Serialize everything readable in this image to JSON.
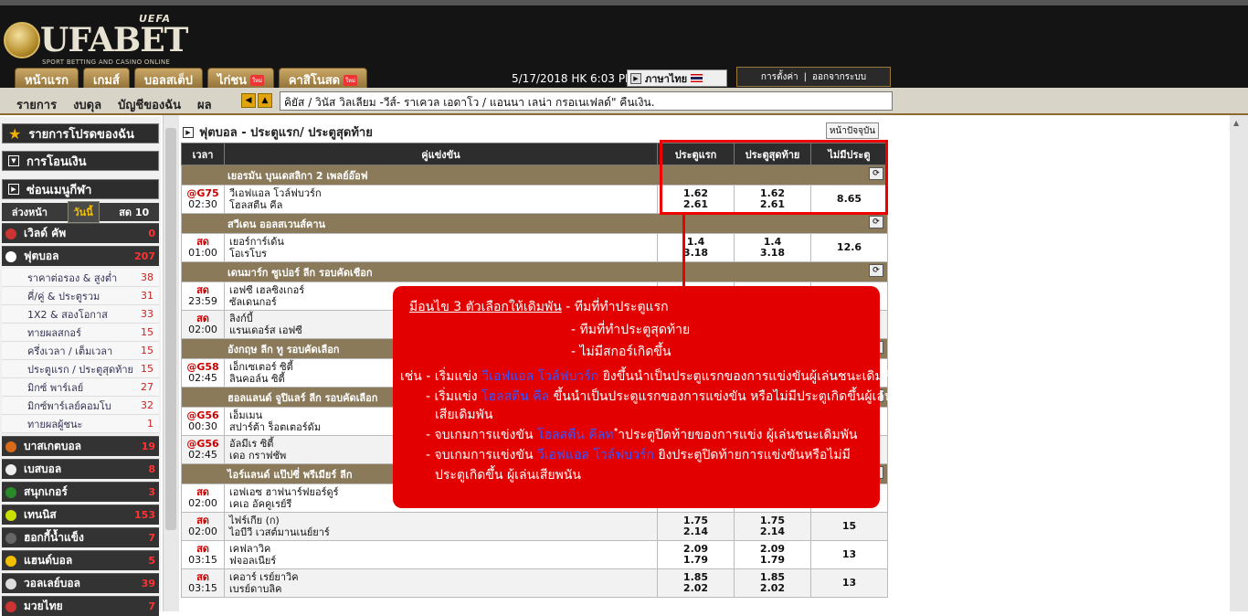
{
  "brand": {
    "name": "UFABET",
    "uefa": "UEFA",
    "tagline": "SPORT BETTING AND CASINO ONLINE"
  },
  "nav_tabs": [
    {
      "label": "หน้าแรก",
      "badge": ""
    },
    {
      "label": "เกมส์",
      "badge": ""
    },
    {
      "label": "บอลสเต็ป",
      "badge": ""
    },
    {
      "label": "ไก่ชน",
      "badge": "ใหม่"
    },
    {
      "label": "คาสิโนสด",
      "badge": "ใหม่"
    }
  ],
  "datetime": "5/17/2018 HK 6:03 PM",
  "language": "ภาษาไทย",
  "settings": {
    "label1": "การตั้งค่า",
    "sep": "|",
    "label2": "ออกจากระบบ"
  },
  "subnav": [
    "รายการ",
    "งบดุล",
    "บัญชีของฉัน",
    "ผล"
  ],
  "ticker": "คิยัส / วินัส วิลเลียม -วีส์- ราเควล เอดาโว / แอนนา เลน่า กรอเนเฟลด์\" คืนเงิน.",
  "sidebar": {
    "headers": [
      "รายการโปรดของฉัน",
      "การโอนเงิน",
      "ซ่อนเมนูกีฬา"
    ],
    "tabs": [
      "ล่วงหน้า",
      "วันนี้",
      "สด 10"
    ],
    "sports": [
      {
        "name": "เวิลด์ คัพ",
        "count": "0",
        "color": "#c33"
      },
      {
        "name": "ฟุตบอล",
        "count": "207",
        "color": "#fff"
      },
      {
        "name": "บาสเกตบอล",
        "count": "19",
        "color": "#d86a1a"
      },
      {
        "name": "เบสบอล",
        "count": "8",
        "color": "#eee"
      },
      {
        "name": "สนุกเกอร์",
        "count": "3",
        "color": "#2a8a2a"
      },
      {
        "name": "เทนนิส",
        "count": "153",
        "color": "#c9e000"
      },
      {
        "name": "ฮอกกี้น้ำแข็ง",
        "count": "7",
        "color": "#666"
      },
      {
        "name": "แฮนด์บอล",
        "count": "5",
        "color": "#f0c000"
      },
      {
        "name": "วอลเลย์บอล",
        "count": "39",
        "color": "#ddd"
      },
      {
        "name": "มวยไทย",
        "count": "7",
        "color": "#c33"
      }
    ],
    "football_sub": [
      {
        "name": "ราคาต่อรอง & สูงต่ำ",
        "count": "38"
      },
      {
        "name": "คี่/คู่ & ประตูรวม",
        "count": "31"
      },
      {
        "name": "1X2 & สองโอกาส",
        "count": "33"
      },
      {
        "name": "ทายผลสกอร์",
        "count": "15"
      },
      {
        "name": "ครึ่งเวลา / เต็มเวลา",
        "count": "15"
      },
      {
        "name": "ประตูแรก / ประตูสุดท้าย",
        "count": "15"
      },
      {
        "name": "มิกซ์ พาร์เลย์",
        "count": "27"
      },
      {
        "name": "มิกซ์พาร์เลย์คอมโบ",
        "count": "32"
      },
      {
        "name": "ทายผลผู้ชนะ",
        "count": "1"
      }
    ]
  },
  "page": {
    "title": "ฟุตบอล - ประตูแรก/ ประตูสุดท้าย",
    "now_button": "หน้าปัจจุบัน"
  },
  "table": {
    "headers": [
      "เวลา",
      "คู่แข่งขัน",
      "ประตูแรก",
      "ประตูสุดท้าย",
      "ไม่มีประตู"
    ],
    "rows": [
      {
        "type": "league",
        "name": "เยอรมัน บุนเดสลิกา 2 เพลย์อ๊อฟ"
      },
      {
        "type": "match",
        "live": "@G75",
        "time": "02:30",
        "home": "วีเอฟแอล โวล์ฟบวร์ก",
        "away": "โฮลสตีน คีล",
        "fg": [
          "1.62",
          "2.61"
        ],
        "lg": [
          "1.62",
          "2.61"
        ],
        "ng": "8.65"
      },
      {
        "type": "league",
        "name": "สวีเดน ออลสเวนส์คาน"
      },
      {
        "type": "match",
        "live": "สด",
        "time": "01:00",
        "home": "เยอร์การ์เด้น",
        "away": "โอเรโบร",
        "fg": [
          "1.4",
          "3.18"
        ],
        "lg": [
          "1.4",
          "3.18"
        ],
        "ng": "12.6"
      },
      {
        "type": "league",
        "name": "เดนมาร์ก ซูเปอร์ ลีก รอบคัดเชือก"
      },
      {
        "type": "match",
        "live": "สด",
        "time": "23:59",
        "home": "เอฟซี เฮลซิงเกอร์",
        "away": "ซัลเดนกอร์",
        "fg": [
          "",
          ""
        ],
        "lg": [
          "",
          ""
        ],
        "ng": ""
      },
      {
        "type": "match",
        "live": "สด",
        "time": "02:00",
        "home": "ลิงก์บี้",
        "away": "แรนเดอร์ส เอฟซี",
        "fg": [
          "",
          ""
        ],
        "lg": [
          "",
          ""
        ],
        "ng": ""
      },
      {
        "type": "league",
        "name": "อังกฤษ ลีก ทู รอบคัดเลือก"
      },
      {
        "type": "match",
        "live": "@G58",
        "time": "02:45",
        "home": "เอ็กเซเตอร์ ซิตี้",
        "away": "ลินคอล์น ซิตี้",
        "fg": [
          "",
          ""
        ],
        "lg": [
          "",
          ""
        ],
        "ng": ""
      },
      {
        "type": "league",
        "name": "ฮอลแลนด์ จูปิแลร์ ลีก รอบคัดเลือก"
      },
      {
        "type": "match",
        "live": "@G56",
        "time": "00:30",
        "home": "เอ็มเมน",
        "away": "สปาร์ต้า ร็อตเตอร์ดัม",
        "fg": [
          "",
          ""
        ],
        "lg": [
          "",
          ""
        ],
        "ng": ""
      },
      {
        "type": "match",
        "live": "@G56",
        "time": "02:45",
        "home": "อัลมีเร ซิตี้",
        "away": "เดอ กราฟชัพ",
        "fg": [
          "",
          ""
        ],
        "lg": [
          "",
          ""
        ],
        "ng": ""
      },
      {
        "type": "league",
        "name": "ไอร์แลนด์ แป๊ปซี่ พรีเมียร์ ลีก"
      },
      {
        "type": "match",
        "live": "สด",
        "time": "02:00",
        "home": "เอฟเอซ ฮาฟนาร์ฟยอร์ดูร์",
        "away": "เคเอ อัคคูเรย์รี",
        "fg": [
          "",
          ""
        ],
        "lg": [
          "",
          ""
        ],
        "ng": ""
      },
      {
        "type": "match",
        "live": "สด",
        "time": "02:00",
        "home": "ไฟร์เกีย (ก)",
        "away": "ไอบีวี เวสต์มานเนย์ยาร์",
        "fg": [
          "1.75",
          "2.14"
        ],
        "lg": [
          "1.75",
          "2.14"
        ],
        "ng": "15"
      },
      {
        "type": "match",
        "live": "สด",
        "time": "03:15",
        "home": "เคฟลาวิค",
        "away": "ฟจอลเนียร์",
        "fg": [
          "2.09",
          "1.79"
        ],
        "lg": [
          "2.09",
          "1.79"
        ],
        "ng": "13"
      },
      {
        "type": "match",
        "live": "สด",
        "time": "03:15",
        "home": "เคอาร์ เรย์ยาวิค",
        "away": "เบรย์ดาบลิค",
        "fg": [
          "1.85",
          "2.02"
        ],
        "lg": [
          "1.85",
          "2.02"
        ],
        "ng": "13"
      }
    ]
  },
  "popup": {
    "l1a": "มีอนไข 3 ตัวเลือกให้เดิมพัน",
    "l1b": " - ทีมที่ทำประตูแรก",
    "l2": "- ทีมที่ทำประตูสุดท้าย",
    "l3": "- ไม่มีสกอร์เกิดขึ้น",
    "l4a": "เช่น - เริ่มแข่ง ",
    "l4b": "วีเอฟแอล โวล์ฟบวร์ก",
    "l4c": " ยิงขึ้นนำเป็นประตูแรกของการแข่งขันผู้เล่นชนะเดิมพัน",
    "l5a": "- เริ่มแข่ง ",
    "l5b": "โฮลสตีน คีล",
    "l5c": " ขึ้นนำเป็นประตูแรกของการแข่งขัน หรือไม่มีประตูเกิดขึ้นผู้เล่น",
    "l6": "เสียเดิมพัน",
    "l7a": "- จบเกมการแข่งขัน ",
    "l7b": "โฮลสตีน คีลท",
    "l7c": " ำประตูปิดท้ายของการแข่ง ผู้เล่นชนะเดิมพัน",
    "l8a": "- จบเกมการแข่งขัน ",
    "l8b": "วีเอฟแอล โวล์ฟบวร์ก",
    "l8c": " ยิงประตูปิดท้ายการแข่งขันหรือไม่มี",
    "l9": "ประตูเกิดขึ้น ผู้เล่นเสียพนัน"
  }
}
